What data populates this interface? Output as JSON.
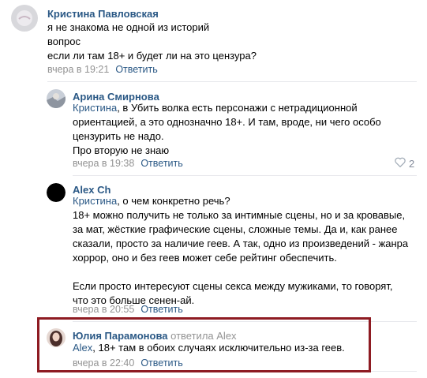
{
  "comments": [
    {
      "author": "Кристина Павловская",
      "lines": [
        "я не знакома не одной из историй",
        "вопрос",
        "если ли там 18+ и будет ли на это цензура?"
      ],
      "time": "вчера в 19:21",
      "reply_label": "Ответить"
    },
    {
      "author": "Арина Смирнова",
      "mention": "Кристина",
      "lines": [
        ", в Убить волка есть персонажи с нетрадиционной",
        "ориентацией, а это однозначно 18+. И там, вроде, ни чего особо",
        "цензурить не надо.",
        "Про вторую не знаю"
      ],
      "time": "вчера в 19:38",
      "reply_label": "Ответить",
      "likes": "2"
    },
    {
      "author": "Alex Ch",
      "mention": "Кристина",
      "lines": [
        ", о чем конкретно речь?",
        "18+ можно получить не только за интимные сцены, но и за кровавые,",
        "за мат, жёсткие графические сцены, сложные темы. Да и, как ранее",
        "сказали, просто за наличие геев. А так, одно из произведений - жанра",
        "хоррор, оно и без геев может себе рейтинг обеспечить.",
        "",
        "Если просто интересуют сцены секса между мужиками, то говорят,",
        "что это больше сенен-ай."
      ],
      "time": "вчера в 20:55",
      "reply_label": "Ответить"
    },
    {
      "author": "Юлия Парамонова",
      "replied_note": "ответила",
      "replied_to": "Alex",
      "mention": "Alex",
      "lines": [
        ", 18+ там в обоих случаях исключительно из-за геев."
      ],
      "time": "вчера в 22:40",
      "reply_label": "Ответить"
    }
  ],
  "icons": {
    "like": "heart-icon"
  },
  "colors": {
    "link": "#2a5885",
    "meta": "#939393",
    "highlight": "#8e1b22"
  }
}
